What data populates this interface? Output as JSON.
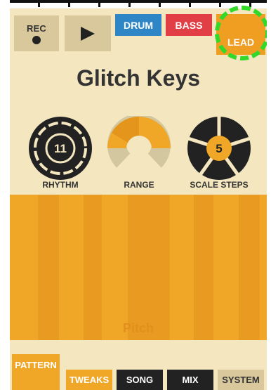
{
  "colors": {
    "background": "#f4e6bf",
    "drum": "#2f86c6",
    "bass": "#e23e45",
    "lead": "#ef9e22",
    "accent": "#f0a728",
    "dark": "#222222",
    "highlight": "#33d92a"
  },
  "transport": {
    "rec_label": "REC",
    "rec_icon": "record-dot-icon",
    "play_icon": "play-icon"
  },
  "instrument_tabs": {
    "drum": "DRUM",
    "bass": "BASS",
    "lead": "LEAD",
    "selected": "LEAD"
  },
  "title": "Glitch Keys",
  "knobs": {
    "rhythm": {
      "label": "RHYTHM",
      "value": "11"
    },
    "range": {
      "label": "RANGE"
    },
    "scale_steps": {
      "label": "SCALE STEPS",
      "value": "5"
    }
  },
  "pitch_area": {
    "label": "Pitch"
  },
  "bottom_tabs": {
    "pattern": "PATTERN",
    "tweaks": "TWEAKS",
    "song": "SONG",
    "mix": "MIX",
    "system": "SYSTEM",
    "selected": "PATTERN"
  }
}
